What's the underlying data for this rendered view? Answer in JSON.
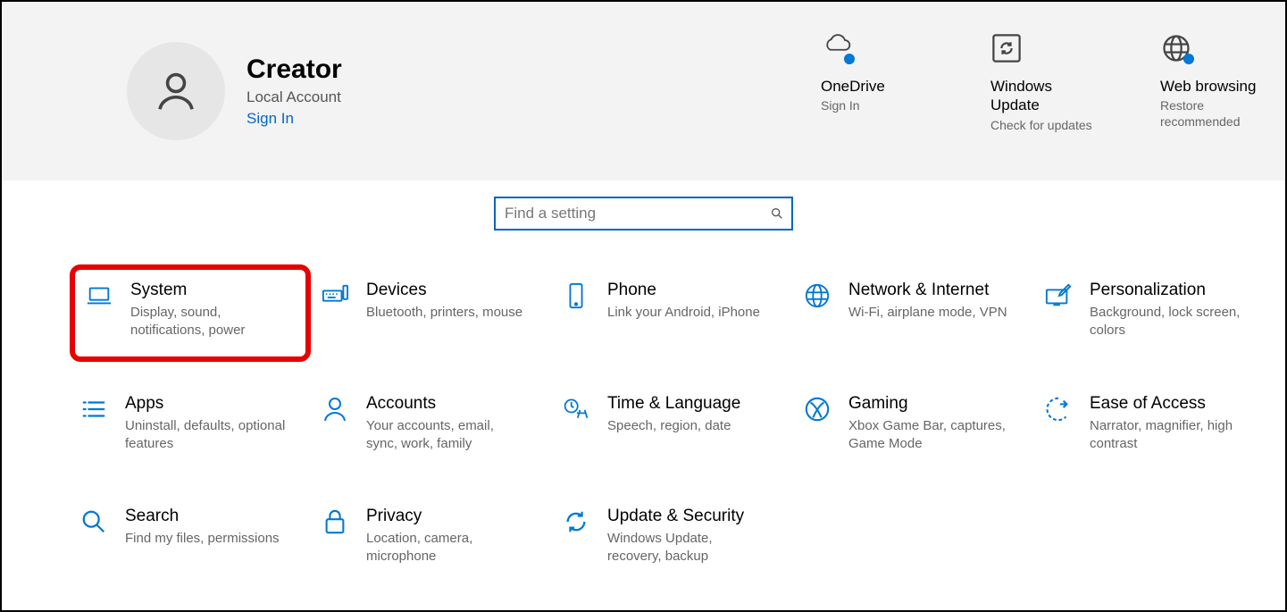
{
  "user": {
    "name": "Creator",
    "account_type": "Local Account",
    "signin_link": "Sign In"
  },
  "header_tiles": {
    "onedrive": {
      "title": "OneDrive",
      "sub": "Sign In"
    },
    "update": {
      "title": "Windows Update",
      "sub": "Check for updates"
    },
    "browsing": {
      "title": "Web browsing",
      "sub": "Restore recommended"
    }
  },
  "search": {
    "placeholder": "Find a setting"
  },
  "categories": {
    "system": {
      "title": "System",
      "desc": "Display, sound, notifications, power"
    },
    "devices": {
      "title": "Devices",
      "desc": "Bluetooth, printers, mouse"
    },
    "phone": {
      "title": "Phone",
      "desc": "Link your Android, iPhone"
    },
    "network": {
      "title": "Network & Internet",
      "desc": "Wi-Fi, airplane mode, VPN"
    },
    "personalization": {
      "title": "Personalization",
      "desc": "Background, lock screen, colors"
    },
    "apps": {
      "title": "Apps",
      "desc": "Uninstall, defaults, optional features"
    },
    "accounts": {
      "title": "Accounts",
      "desc": "Your accounts, email, sync, work, family"
    },
    "time": {
      "title": "Time & Language",
      "desc": "Speech, region, date"
    },
    "gaming": {
      "title": "Gaming",
      "desc": "Xbox Game Bar, captures, Game Mode"
    },
    "ease": {
      "title": "Ease of Access",
      "desc": "Narrator, magnifier, high contrast"
    },
    "search_cat": {
      "title": "Search",
      "desc": "Find my files, permissions"
    },
    "privacy": {
      "title": "Privacy",
      "desc": "Location, camera, microphone"
    },
    "update_sec": {
      "title": "Update & Security",
      "desc": "Windows Update, recovery, backup"
    }
  }
}
